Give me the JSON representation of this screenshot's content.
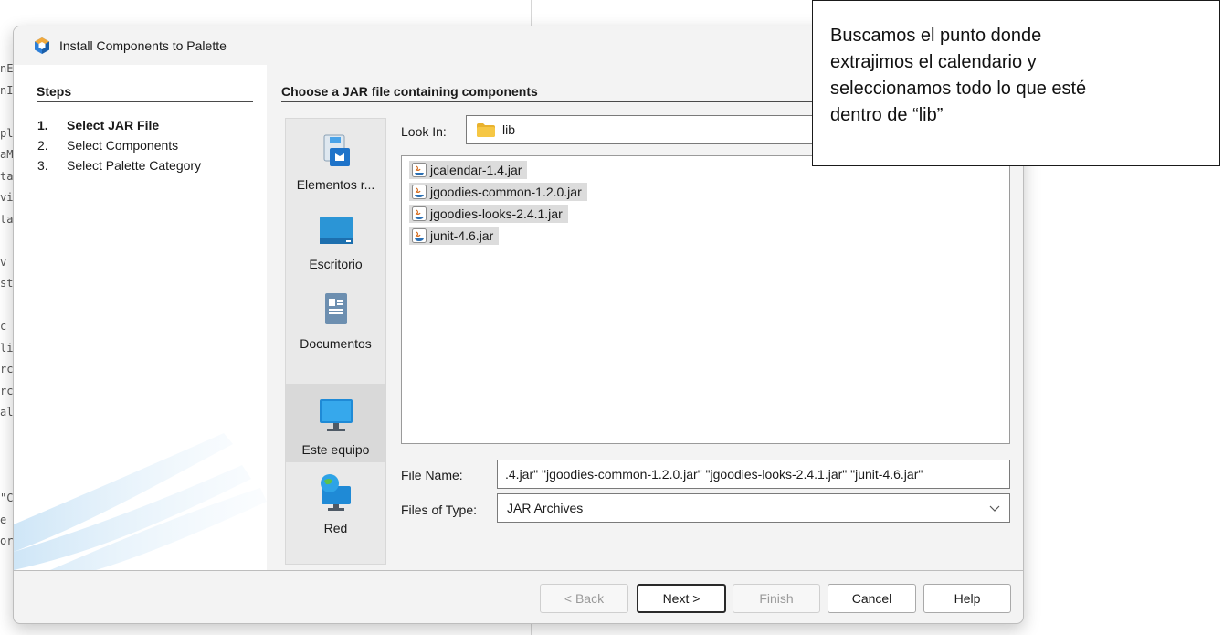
{
  "background_code": [
    "nE",
    "nI",
    "",
    "pl",
    "aM",
    "ta",
    "vi",
    "ta",
    "",
    "v",
    "st",
    "",
    "c",
    "li",
    "rc",
    "rc",
    "al",
    "",
    "",
    "",
    "\"C",
    "e",
    "or"
  ],
  "dialog": {
    "title": "Install Components to Palette",
    "steps": {
      "title": "Steps",
      "items": [
        {
          "num": "1.",
          "label": "Select JAR File",
          "active": true
        },
        {
          "num": "2.",
          "label": "Select Components",
          "active": false
        },
        {
          "num": "3.",
          "label": "Select Palette Category",
          "active": false
        }
      ]
    },
    "content_title": "Choose a JAR file containing components",
    "places": [
      {
        "label": "Elementos r...",
        "icon": "recent-items-icon"
      },
      {
        "label": "Escritorio",
        "icon": "desktop-icon"
      },
      {
        "label": "Documentos",
        "icon": "documents-icon"
      },
      {
        "label": "Este equipo",
        "icon": "this-pc-icon",
        "selected": true
      },
      {
        "label": "Red",
        "icon": "network-icon"
      }
    ],
    "look_in": {
      "label": "Look In:",
      "value": "lib"
    },
    "files": [
      "jcalendar-1.4.jar",
      "jgoodies-common-1.2.0.jar",
      "jgoodies-looks-2.4.1.jar",
      "junit-4.6.jar"
    ],
    "file_name": {
      "label": "File Name:",
      "value": ".4.jar\" \"jgoodies-common-1.2.0.jar\" \"jgoodies-looks-2.4.1.jar\" \"junit-4.6.jar\""
    },
    "files_of_type": {
      "label": "Files of Type:",
      "value": "JAR Archives"
    },
    "buttons": {
      "back": "< Back",
      "next": "Next >",
      "finish": "Finish",
      "cancel": "Cancel",
      "help": "Help"
    }
  },
  "annotation": {
    "lines": [
      "Buscamos el punto donde",
      "extrajimos el calendario y",
      "seleccionamos todo lo que esté",
      "dentro de “lib”"
    ]
  },
  "colors": {
    "accent": "#2d7fd8",
    "folder": "#f5c542",
    "dialog_bg": "#f3f3f3"
  }
}
